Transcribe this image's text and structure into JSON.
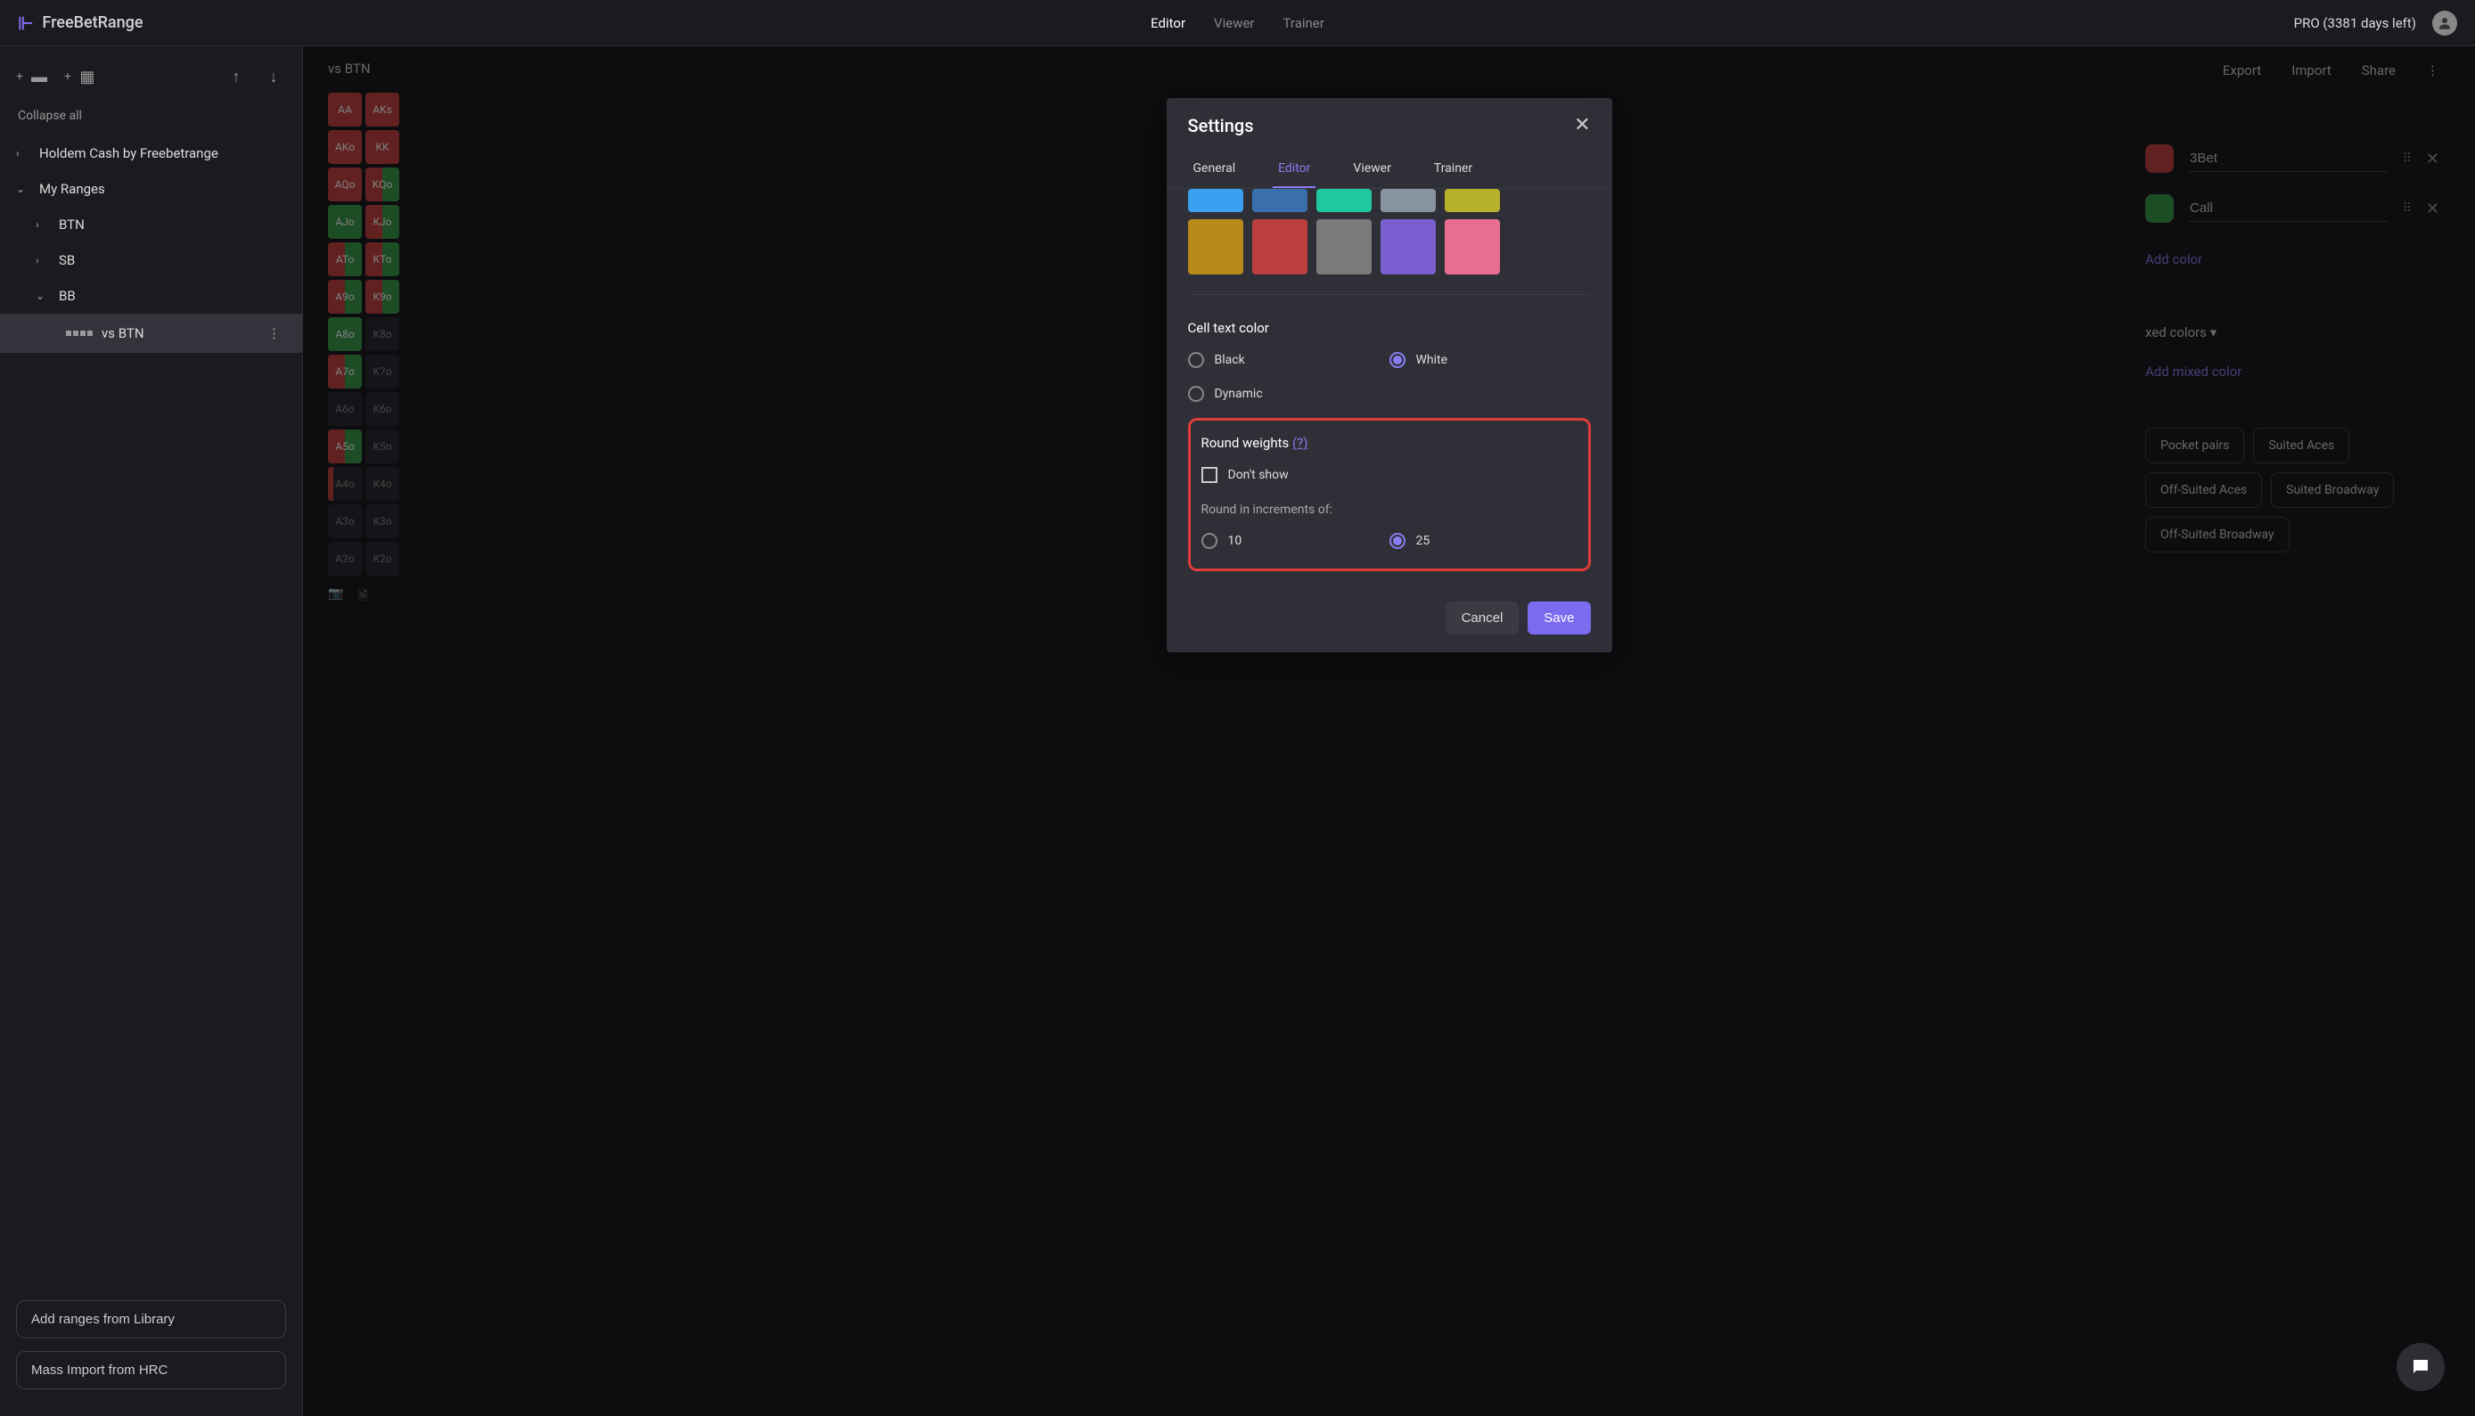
{
  "brand": "FreeBetRange",
  "topnav": {
    "editor": "Editor",
    "viewer": "Viewer",
    "trainer": "Trainer"
  },
  "pro": "PRO (3381 days left)",
  "sidebar": {
    "collapse": "Collapse all",
    "h1": "Holdem Cash by Freebetrange",
    "h2": "My Ranges",
    "btn_l": "BTN",
    "sb_l": "SB",
    "bb_l": "BB",
    "leaf": "vs BTN",
    "add_lib": "Add ranges from Library",
    "mass_import": "Mass Import from HRC"
  },
  "crumb": "vs BTN",
  "topactions": {
    "export": "Export",
    "import": "Import",
    "share": "Share"
  },
  "grid": [
    [
      "AA",
      "AKs"
    ],
    [
      "AKo",
      "KK"
    ],
    [
      "AQo",
      "KQo"
    ],
    [
      "AJo",
      "KJo"
    ],
    [
      "ATo",
      "KTo"
    ],
    [
      "A9o",
      "K9o"
    ],
    [
      "A8o",
      "K8o"
    ],
    [
      "A7o",
      "K7o"
    ],
    [
      "A6o",
      "K6o"
    ],
    [
      "A5o",
      "K5o"
    ],
    [
      "A4o",
      "K4o"
    ],
    [
      "A3o",
      "K3o"
    ],
    [
      "A2o",
      "K2o"
    ]
  ],
  "actions": {
    "bet3": "3Bet",
    "call": "Call",
    "add_color": "Add color",
    "mixed_hdr": "xed colors ▾",
    "add_mixed": "Add mixed color"
  },
  "chips": {
    "pp": "Pocket pairs",
    "sa": "Suited Aces",
    "osa": "Off-Suited Aces",
    "sb": "Suited Broadway",
    "osb": "Off-Suited Broadway"
  },
  "modal": {
    "title": "Settings",
    "tabs": {
      "general": "General",
      "editor": "Editor",
      "viewer": "Viewer",
      "trainer": "Trainer"
    },
    "cell_color_title": "Cell text color",
    "black": "Black",
    "white": "White",
    "dynamic": "Dynamic",
    "rw_title": "Round weights",
    "rw_help": "(?)",
    "dont_show": "Don't show",
    "increments": "Round in increments of:",
    "ten": "10",
    "twentyfive": "25",
    "cancel": "Cancel",
    "save": "Save"
  },
  "swatches_top": [
    "#3aa0ef",
    "#3a6fae",
    "#1ec9a0",
    "#8894a0",
    "#b7b02a"
  ],
  "swatches_bot": [
    "#b78a1a",
    "#bc3f3f",
    "#7a7a7a",
    "#7a5fd0",
    "#e86e92"
  ]
}
